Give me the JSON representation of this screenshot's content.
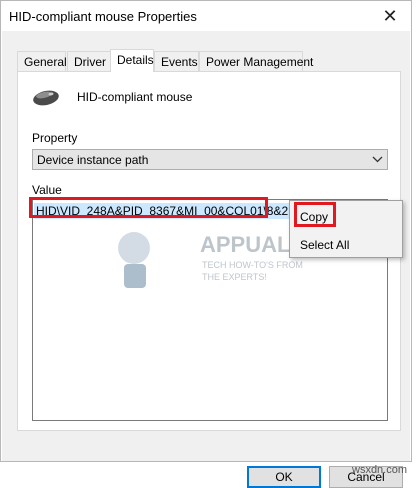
{
  "window": {
    "title": "HID-compliant mouse Properties",
    "close_glyph": "✕"
  },
  "tabs": [
    {
      "label": "General",
      "active": false
    },
    {
      "label": "Driver",
      "active": false
    },
    {
      "label": "Details",
      "active": true
    },
    {
      "label": "Events",
      "active": false
    },
    {
      "label": "Power Management",
      "active": false
    }
  ],
  "details": {
    "device_name": "HID-compliant mouse",
    "device_icon": "mouse-icon",
    "property_label": "Property",
    "property_value": "Device instance path",
    "value_label": "Value",
    "value_text": "HID\\VID_248A&PID_8367&MI_00&COL01\\8&2",
    "selection_color": "#cce8ff"
  },
  "context_menu": {
    "copy_label": "Copy",
    "select_all_label": "Select All"
  },
  "watermark": {
    "brand": "APPUALS",
    "tagline_1": "TECH HOW-TO'S FROM",
    "tagline_2": "THE EXPERTS!"
  },
  "buttons": {
    "ok_label": "OK",
    "cancel_label": "Cancel"
  },
  "site_watermark": "wsxdn.com",
  "colors": {
    "annotation_red": "#e0181f",
    "accent_blue": "#0078d7"
  }
}
